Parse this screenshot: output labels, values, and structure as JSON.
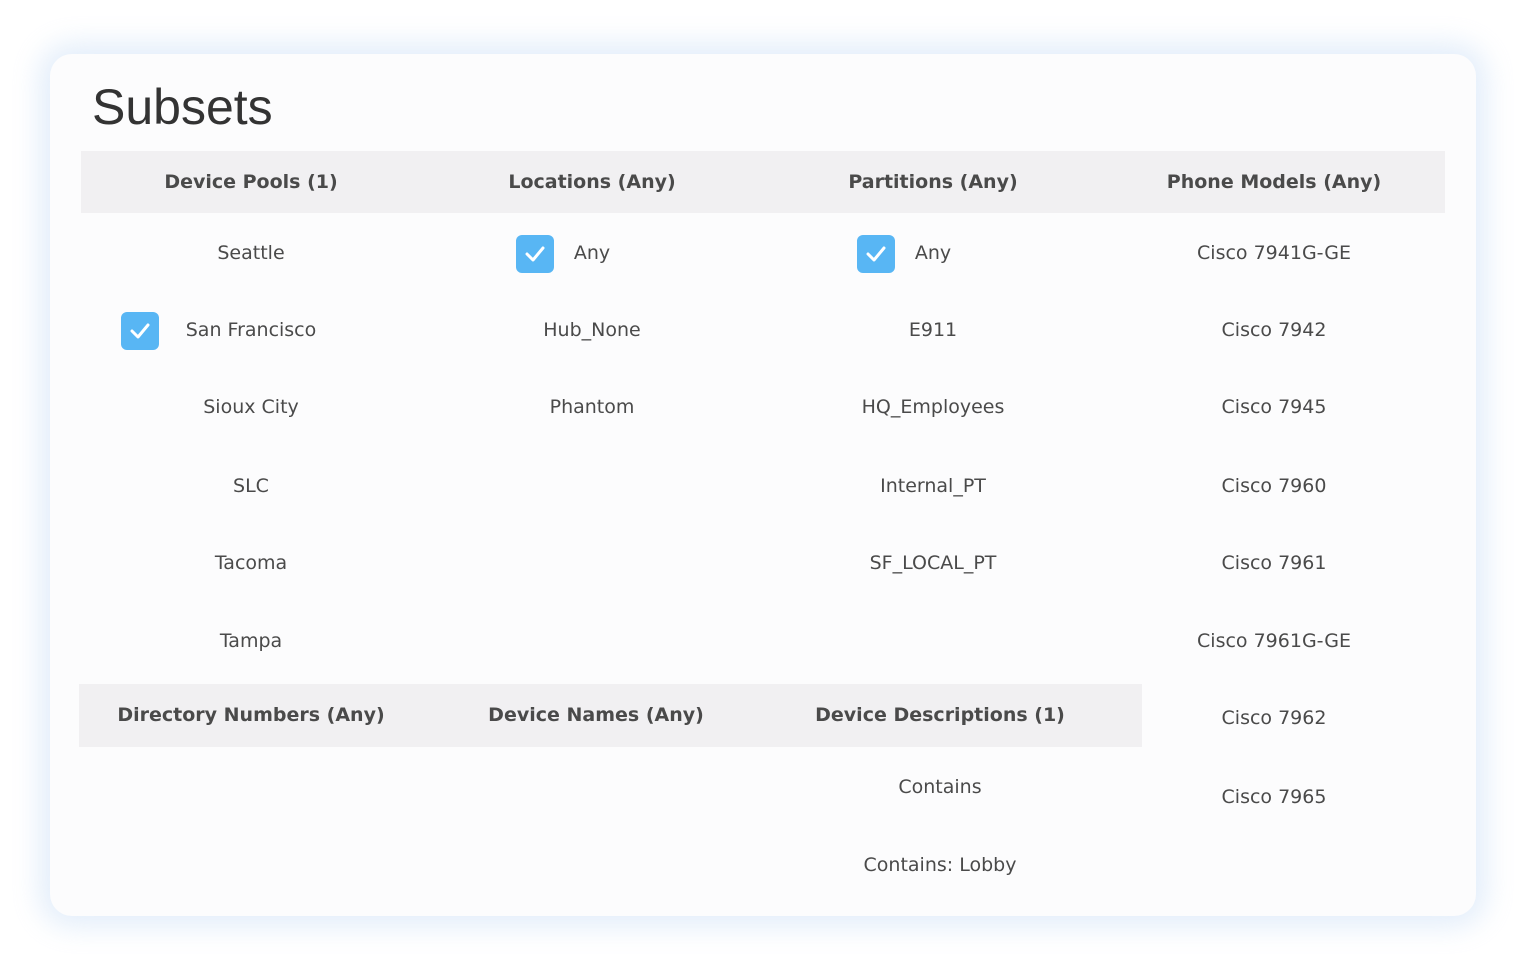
{
  "title": "Subsets",
  "headers_top": [
    "Device Pools (1)",
    "Locations (Any)",
    "Partitions (Any)",
    "Phone Models (Any)"
  ],
  "device_pools": [
    "Seattle",
    "San Francisco",
    "Sioux City",
    "SLC",
    "Tacoma",
    "Tampa"
  ],
  "locations": [
    "Any",
    "Hub_None",
    "Phantom"
  ],
  "partitions": [
    "Any",
    "E911",
    "HQ_Employees",
    "Internal_PT",
    "SF_LOCAL_PT"
  ],
  "phone_models": [
    "Cisco 7941G-GE",
    "Cisco 7942",
    "Cisco 7945",
    "Cisco 7960",
    "Cisco 7961",
    "Cisco 7961G-GE",
    "Cisco 7962",
    "Cisco 7965"
  ],
  "headers_bottom": [
    "Directory Numbers (Any)",
    "Device Names (Any)",
    "Device Descriptions (1)"
  ],
  "device_descriptions": [
    "Contains",
    "Contains: Lobby"
  ],
  "checked": {
    "device_pools": "San Francisco",
    "locations": "Any",
    "partitions": "Any"
  },
  "colors": {
    "checkbox": "#58b6f4",
    "header_bg": "#f1f0f2",
    "text": "#4a4a4a"
  },
  "icons": {
    "checkbox": "checkmark-icon"
  }
}
